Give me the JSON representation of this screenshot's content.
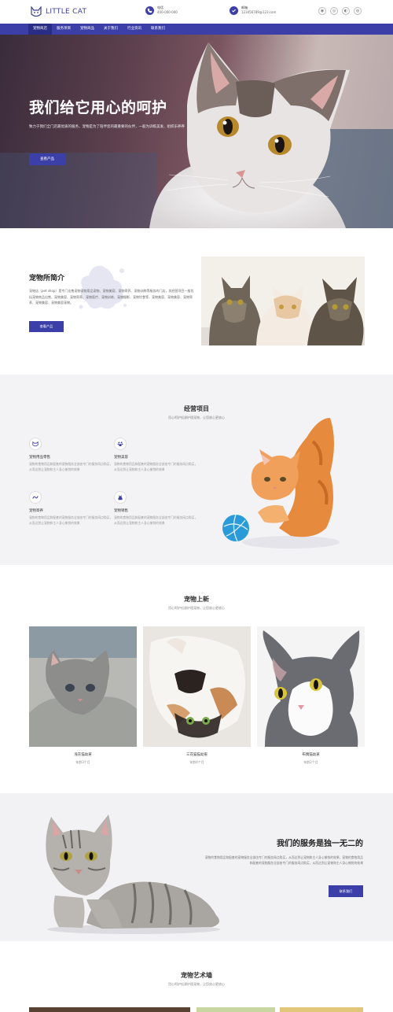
{
  "header": {
    "logo_text": "LITTLE CAT",
    "phone_label": "电话",
    "phone_value": "400-000-000",
    "email_label": "邮箱",
    "email_value": "123456789@123.com",
    "social_icons": [
      "weibo-icon",
      "wechat-icon",
      "qq-icon",
      "eye-icon"
    ]
  },
  "nav": {
    "items": [
      "宠物商店",
      "服务项目",
      "宠物商品",
      "关于我们",
      "行业资讯",
      "联系我们"
    ],
    "active_index": 0
  },
  "hero": {
    "title": "我们给它用心的呵护",
    "subtitle": "致力于我们全门店最优质的服务，宠物是为了陪伴您的最重要的伙伴，一般为训练美发、组织乐养养",
    "button": "查看产品"
  },
  "about": {
    "title": "宠物所简介",
    "text": "宠物店（pet shop）是专门出售宠物宠物用品宠物、宠物美容、宠物寄养、宠物训练等服务的门店，其经营项目一般包括宠物商品出售、宠物美容、宠物寄养、宠物医疗、宠物训练、宠物摄影、宠物饮食等，宠物美容、宠物美容、宠物寄养、宠物美容、宠物美容宠物。",
    "button": "查看产品"
  },
  "services": {
    "title": "经营项目",
    "subtitle": "用心呵护松源护理宠物，让您放心更放心",
    "items": [
      {
        "name": "宠物用品零售",
        "desc": "宠物的食物用品和配套的宠物服务全部由专门的服务网点购买，从而达到让宠物和主人身心愉悦的效果",
        "icon": "cat-face-icon"
      },
      {
        "name": "宠物美容",
        "desc": "宠物的食物用品和配套的宠物服务全部由专门的服务网点购买，从而达到让宠物和主人身心愉悦的效果",
        "icon": "paw-icon"
      },
      {
        "name": "宠物寄养",
        "desc": "宠物的食物用品和配套的宠物服务全部由专门的服务网点购买，从而达到让宠物和主人身心愉悦的效果",
        "icon": "wave-icon"
      },
      {
        "name": "宠物销售",
        "desc": "宠物的食物用品和配套的宠物服务全部由专门的服务网点购买，从而达到让宠物和主人身心愉悦的效果",
        "icon": "cat-sit-icon"
      }
    ]
  },
  "newpets": {
    "title": "宠物上新",
    "subtitle": "用心呵护松源护理宠物，让您放心更放心",
    "cards": [
      {
        "name": "浅灰猫幼崽",
        "age": "年龄3个月"
      },
      {
        "name": "三花猫猫幼崽",
        "age": "年龄4个月"
      },
      {
        "name": "布偶猫幼崽",
        "age": "年龄2个月"
      }
    ]
  },
  "unique": {
    "title": "我们的服务是独一无二的",
    "text": "宠物的食物用品和配套的宠物服务全部由专门的服务网点购买，从而达到让宠物和主人身心愉悦的效果，宠物的食物用品和配套的宠物服务全部由专门的服务网点购买，从而达到让宠物和主人身心愉悦的效果",
    "button": "联系我们"
  },
  "art": {
    "title": "宠物艺术墙",
    "subtitle": "用心呵护松源护理宠物，让您放心更放心"
  }
}
